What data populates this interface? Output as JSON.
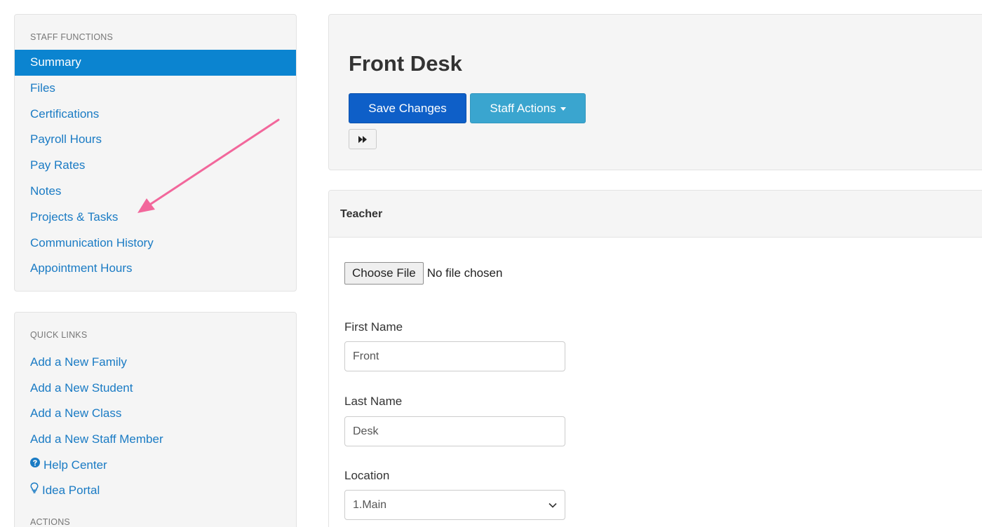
{
  "sidebar": {
    "staff_functions": {
      "header": "STAFF FUNCTIONS",
      "items": [
        {
          "label": "Summary"
        },
        {
          "label": "Files"
        },
        {
          "label": "Certifications"
        },
        {
          "label": "Payroll Hours"
        },
        {
          "label": "Pay Rates"
        },
        {
          "label": "Notes"
        },
        {
          "label": "Projects & Tasks"
        },
        {
          "label": "Communication History"
        },
        {
          "label": "Appointment Hours"
        }
      ]
    },
    "quick_links": {
      "header": "QUICK LINKS",
      "items": [
        {
          "label": "Add a New Family"
        },
        {
          "label": "Add a New Student"
        },
        {
          "label": "Add a New Class"
        },
        {
          "label": "Add a New Staff Member"
        },
        {
          "label": "Help Center",
          "icon": "question-circle-icon"
        },
        {
          "label": "Idea Portal",
          "icon": "lightbulb-icon"
        }
      ],
      "next_header": "ACTIONS"
    }
  },
  "main": {
    "title": "Front Desk",
    "save_label": "Save Changes",
    "actions_label": "Staff Actions",
    "fast_forward_icon": "fast-forward-icon"
  },
  "form": {
    "panel_title": "Teacher",
    "file_button": "Choose File",
    "file_status": "No file chosen",
    "first_name_label": "First Name",
    "first_name_value": "Front",
    "last_name_label": "Last Name",
    "last_name_value": "Desk",
    "location_label": "Location",
    "location_value": "1.Main"
  },
  "colors": {
    "active_nav": "#0b84d0",
    "link": "#1a7bc4",
    "save_button": "#0e5fc8",
    "actions_button": "#3aa5cf",
    "annotation_arrow": "#f2679b"
  }
}
